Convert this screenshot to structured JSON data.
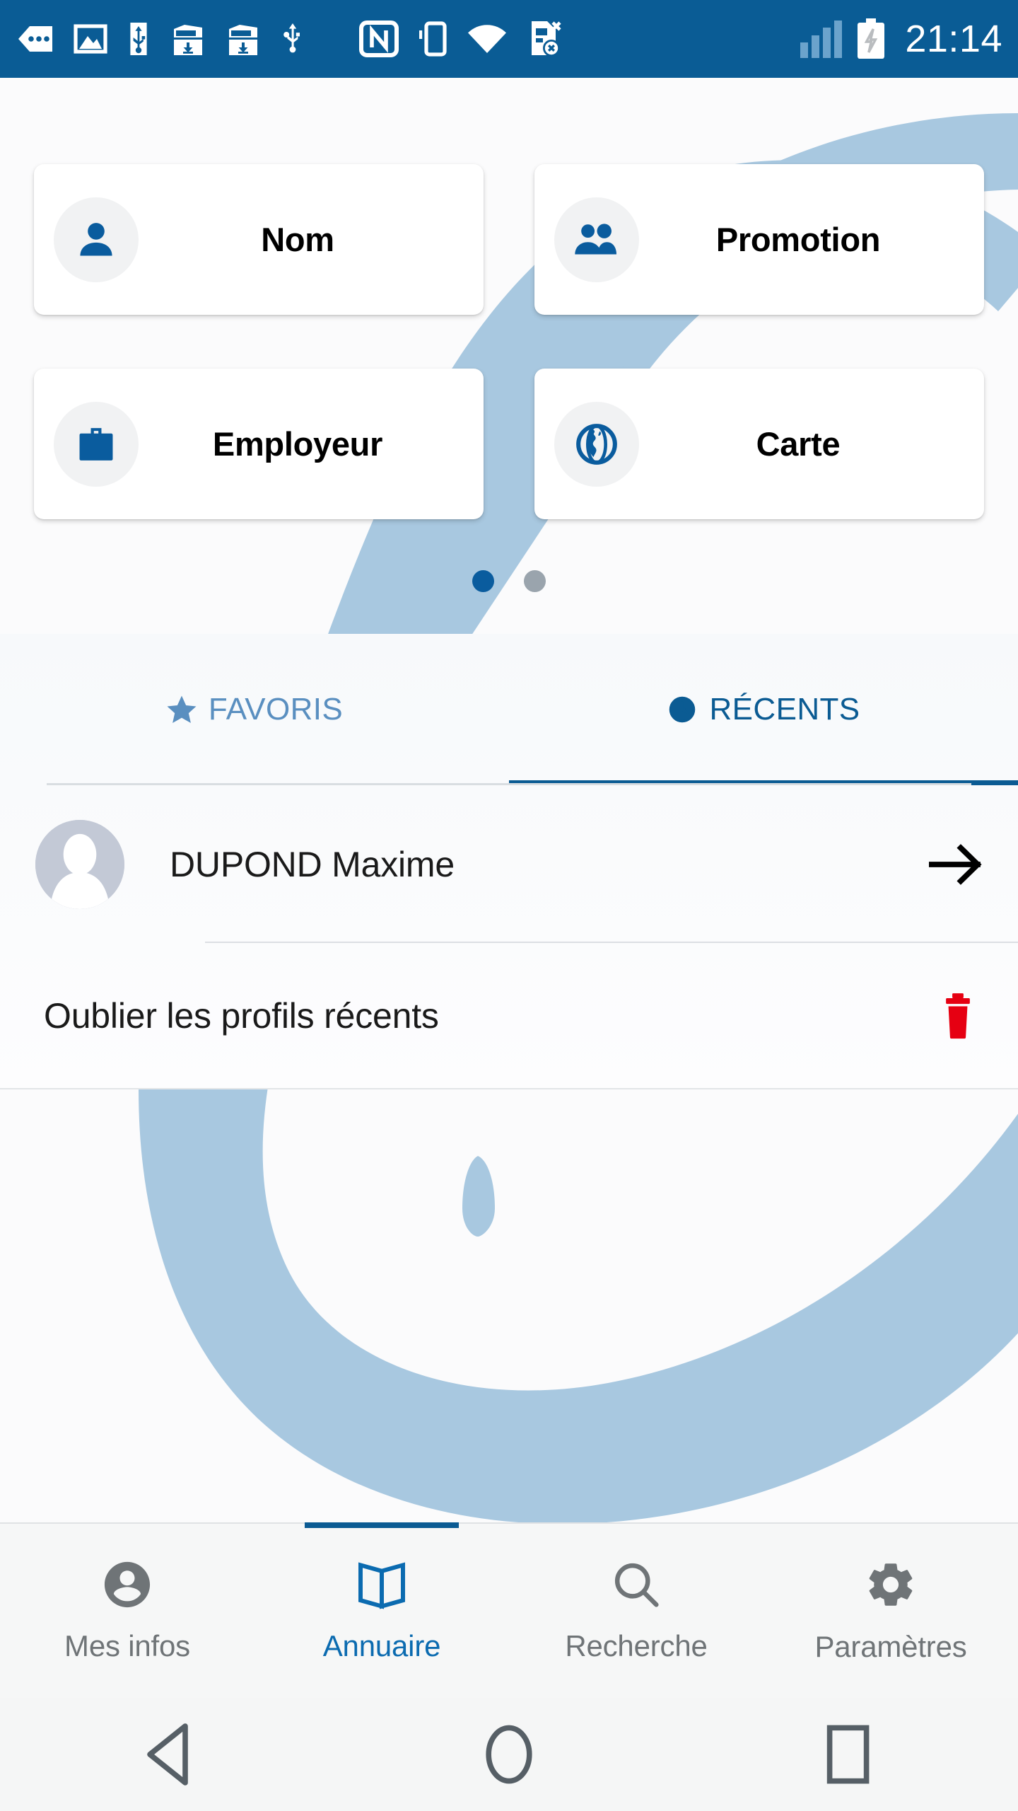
{
  "status_bar": {
    "time": "21:14",
    "background": "#0a5c95",
    "icons": [
      "chevron-left-more-icon",
      "image-icon",
      "usb-icon",
      "package-download-icon",
      "package-download-icon",
      "usb-upload-icon",
      "nfc-icon",
      "vibrate-icon",
      "wifi-icon",
      "sim-card-error-icon",
      "signal-bars-icon",
      "battery-charging-icon"
    ]
  },
  "search_tiles": {
    "items": [
      {
        "label": "Nom",
        "icon": "person-icon"
      },
      {
        "label": "Promotion",
        "icon": "people-group-icon"
      },
      {
        "label": "Employeur",
        "icon": "briefcase-icon"
      },
      {
        "label": "Carte",
        "icon": "globe-icon"
      }
    ]
  },
  "pager": {
    "total": 2,
    "active_index": 0
  },
  "tabs": {
    "items": [
      {
        "label": "FAVORIS",
        "icon": "star-icon",
        "active": false
      },
      {
        "label": "RÉCENTS",
        "icon": "clock-icon",
        "active": true
      }
    ]
  },
  "recents": {
    "contacts": [
      {
        "name": "DUPOND Maxime",
        "avatar": "person-placeholder-avatar",
        "chevron": "arrow-right-icon"
      }
    ],
    "forget": {
      "label": "Oublier les profils récents",
      "icon": "trash-icon",
      "icon_color": "#e60012"
    }
  },
  "bottom_nav": {
    "items": [
      {
        "label": "Mes infos",
        "icon": "account-circle-icon",
        "active": false
      },
      {
        "label": "Annuaire",
        "icon": "book-open-icon",
        "active": true
      },
      {
        "label": "Recherche",
        "icon": "search-icon",
        "active": false
      },
      {
        "label": "Paramètres",
        "icon": "gear-icon",
        "active": false
      }
    ]
  },
  "system_nav": {
    "items": [
      {
        "name": "back-button",
        "icon": "triangle-left-icon"
      },
      {
        "name": "home-button",
        "icon": "circle-icon"
      },
      {
        "name": "recents-button",
        "icon": "square-icon"
      }
    ]
  },
  "theme": {
    "primary": "#0b5b93",
    "status_bar": "#0a5c95",
    "accent_light": "#a8c8e0",
    "danger": "#e60012",
    "icon_blue": "#0a5c9e"
  }
}
